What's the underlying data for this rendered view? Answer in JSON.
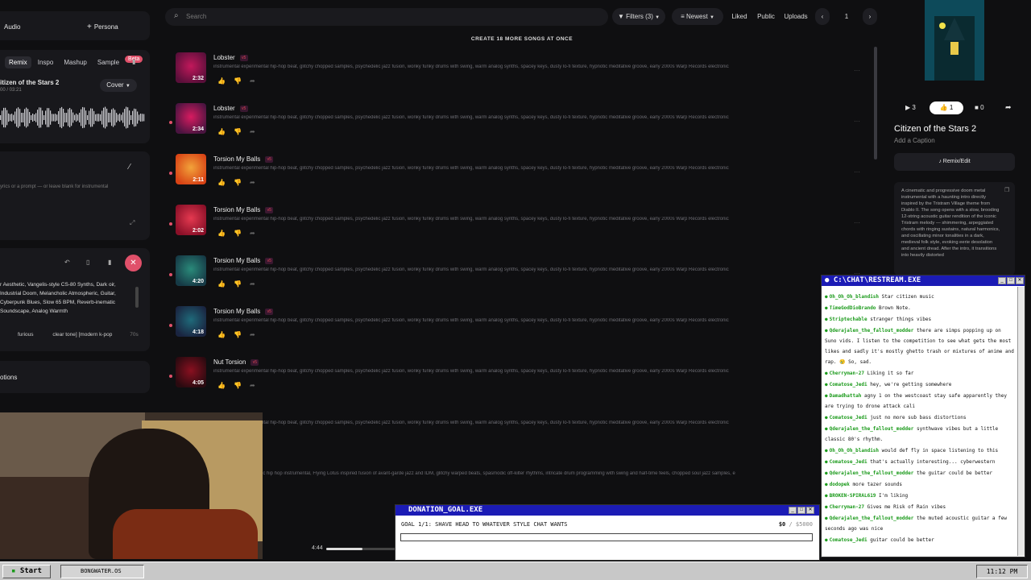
{
  "left_panel": {
    "mode_audio": "Audio",
    "persona_label": "Persona",
    "tabs": [
      "Remix",
      "Inspo",
      "Mashup",
      "Sample"
    ],
    "beta_badge": "Beta",
    "song_title": "itizen of the Stars 2",
    "song_time": "00 / 03:21",
    "cover_label": "Cover",
    "lyrics_placeholder": "yrics or a prompt — or leave blank for instrumental",
    "style_text": "r Aesthetic, Vangelis-style CS-80 Synths, Dark oir, Industrial Doom, Melancholic Atmospheric, Guitar, Cyberpunk Blues, Slow 65 BPM, Reverb-inematic Soundscape, Analog Warmth",
    "style_tags": [
      "furious",
      "clear tone] [modern k-pop",
      "70s"
    ],
    "options_label": "otions"
  },
  "header": {
    "search_placeholder": "Search",
    "filters_label": "Filters (3)",
    "sort_label": "Newest",
    "liked_label": "Liked",
    "public_label": "Public",
    "uploads_label": "Uploads",
    "page_number": "1",
    "create_banner": "CREATE 18 MORE SONGS AT ONCE"
  },
  "songs": [
    {
      "title": "Lobster",
      "duration": "2:32",
      "desc": "instrumental experimental hip-hop beat, glitchy chopped samples, psychedelic jazz fusion, wonky funky drums with swing, warm analog synths, spacey keys, dusty lo-fi texture, hypnotic meditative groove, early 2000s Warp Records electronic",
      "color1": "#c2185b",
      "color2": "#5a0f3a"
    },
    {
      "title": "Lobster",
      "duration": "2:34",
      "desc": "instrumental experimental hip-hop beat, glitchy chopped samples, psychedelic jazz fusion, wonky funky drums with swing, warm analog synths, spacey keys, dusty lo-fi texture, hypnotic meditative groove, early 2000s Warp Records electronic",
      "color1": "#d81b60",
      "color2": "#4a1440"
    },
    {
      "title": "Torsion My Balls",
      "duration": "2:11",
      "desc": "instrumental experimental hip-hop beat, glitchy chopped samples, psychedelic jazz fusion, wonky funky drums with swing, warm analog synths, spacey keys, dusty lo-fi texture, hypnotic meditative groove, early 2000s Warp Records electronic",
      "color1": "#f2a33a",
      "color2": "#d84315"
    },
    {
      "title": "Torsion My Balls",
      "duration": "2:02",
      "desc": "instrumental experimental hip-hop beat, glitchy chopped samples, psychedelic jazz fusion, wonky funky drums with swing, warm analog synths, spacey keys, dusty lo-fi texture, hypnotic meditative groove, early 2000s Warp Records electronic",
      "color1": "#e53950",
      "color2": "#8a1028"
    },
    {
      "title": "Torsion My Balls",
      "duration": "4:20",
      "desc": "instrumental experimental hip-hop beat, glitchy chopped samples, psychedelic jazz fusion, wonky funky drums with swing, warm analog synths, spacey keys, dusty lo-fi texture, hypnotic meditative groove, early 2000s Warp Records electronic",
      "color1": "#2a8a7a",
      "color2": "#163a46"
    },
    {
      "title": "Torsion My Balls",
      "duration": "4:18",
      "desc": "instrumental experimental hip-hop beat, glitchy chopped samples, psychedelic jazz fusion, wonky funky drums with swing, warm analog synths, spacey keys, dusty lo-fi texture, hypnotic meditative groove, early 2000s Warp Records electronic",
      "color1": "#1f6a7a",
      "color2": "#1a2440"
    },
    {
      "title": "Nut Torsion",
      "duration": "4:05",
      "desc": "instrumental experimental hip-hop beat, glitchy chopped samples, psychedelic jazz fusion, wonky funky drums with swing, warm analog synths, spacey keys, dusty lo-fi texture, hypnotic meditative groove, early 2000s Warp Records electronic",
      "color1": "#8a1020",
      "color2": "#2a0a10"
    }
  ],
  "extra_desc_1": "instrumental experimental hip-hop beat, glitchy chopped samples, psychedelic jazz fusion, wonky funky drums with swing, warm analog synths, spacey keys, dusty lo-fi texture, hypnotic meditative groove, early 2000s Warp Records electronic",
  "extra_desc_2": "ic hip hop instrumental, Flying Lotus inspired fusion of avant-garde jazz and IDM, glitchy warped beats, spasmodic off-kilter rhythms, intricate drum programming with swing and half-time feels, chopped soul jazz samples, e",
  "player": {
    "time": "4:44",
    "progress": 0.5
  },
  "right_panel": {
    "play_count": "3",
    "like_count": "1",
    "comment_count": "0",
    "title": "Citizen of the Stars 2",
    "caption_placeholder": "Add a Caption",
    "remix_label": "Remix/Edit",
    "description": "A cinematic and progressive doom metal instrumental with a haunting intro directly inspired by the Tristram Village theme from Diablo II. The song opens with a slow, brooding 12-string acoustic guitar rendition of the iconic Tristram melody — shimmering, arpeggiated chords with ringing sustains, natural harmonics, and oscillating minor tonalities in a dark, medieval folk style, evoking eerie desolation and ancient dread. After the intro, it transitions into heavily distorted"
  },
  "chat": {
    "title": "C:\\CHAT\\RESTREAM.EXE",
    "messages": [
      {
        "user": "Oh_Oh_Oh_blandish",
        "text": "Star citizen music"
      },
      {
        "user": "TimeGodDioBrando",
        "text": "Brown Note."
      },
      {
        "user": "Striptechable",
        "text": "stranger things vibes"
      },
      {
        "user": "Qderajalen_the_fallout_modder",
        "text": "there are simps popping up on Suno vids. I listen to the competition to see what gets the most likes and sadly it's mostly ghetto trash or mixtures of anime and rap. 😢 So, sad."
      },
      {
        "user": "Cherryman-27",
        "text": "Liking it so far"
      },
      {
        "user": "Comatose_Jedi",
        "text": "hey, we're getting somewhere"
      },
      {
        "user": "Damadhattah",
        "text": "agny 1 on the westcoast stay safe apparently they are trying to drone attack cali"
      },
      {
        "user": "Comatose_Jedi",
        "text": "just no more sub bass distortions"
      },
      {
        "user": "Qderajalen_the_fallout_modder",
        "text": "synthwave vibes but a little classic 80's rhythm."
      },
      {
        "user": "Oh_Oh_Oh_blandish",
        "text": "would def fly in space listening to this"
      },
      {
        "user": "Comatose_Jedi",
        "text": "that's actually interesting... cyberwestern"
      },
      {
        "user": "Qderajalen_the_fallout_modder",
        "text": "the guitar could be better"
      },
      {
        "user": "dodopek",
        "text": "more tazer sounds"
      },
      {
        "user": "BROKEN-SPIRAL619",
        "text": "I'm liking"
      },
      {
        "user": "Cherryman-27",
        "text": "Gives me Risk of Rain vibes"
      },
      {
        "user": "Qderajalen_the_fallout_modder",
        "text": "the muted acoustic guitar a few seconds ago was nice"
      },
      {
        "user": "Comatose_Jedi",
        "text": "guitar could be better"
      }
    ]
  },
  "donation": {
    "title": "DONATION_GOAL.EXE",
    "goal_text": "GOAL 1/1: SHAVE HEAD TO WHATEVER STYLE CHAT WANTS",
    "amount": "$0",
    "target": "/ $5000",
    "progress": 0
  },
  "taskbar": {
    "start_label": "Start",
    "item_label": "BONGWATER.OS",
    "clock": "11:12 PM"
  },
  "colors": {
    "accent": "#e0506a",
    "window_title": "#1b1bb5",
    "chat_user": "#1a9a1a"
  }
}
